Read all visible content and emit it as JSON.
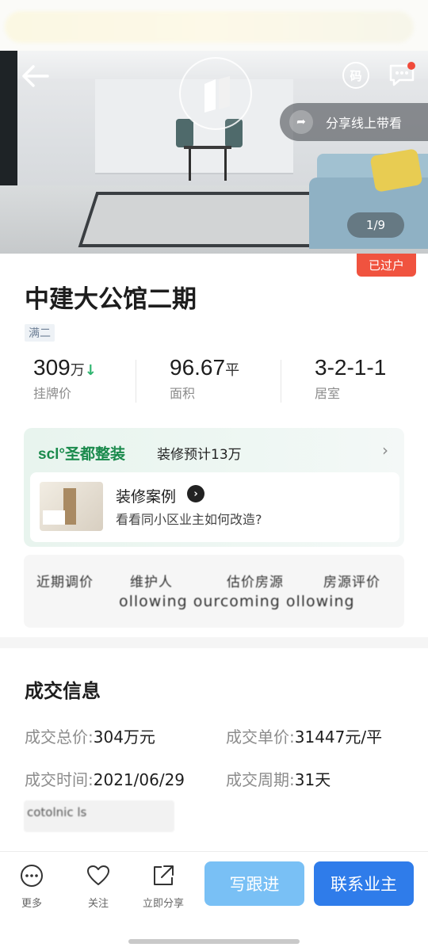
{
  "header": {
    "code_label": "码",
    "share_live": "分享线上带看",
    "photo_counter": "1/9"
  },
  "listing": {
    "status_badge": "已过户",
    "title": "中建大公馆二期",
    "tag": "满二",
    "stats": [
      {
        "value": "309",
        "unit": "万",
        "trend": "↓",
        "label": "挂牌价"
      },
      {
        "value": "96.67",
        "unit": "平",
        "label": "面积"
      },
      {
        "value": "3-2-1-1",
        "label": "居室"
      }
    ]
  },
  "renovation": {
    "brand": "scl°圣都整装",
    "budget": "装修预计13万",
    "case_title": "装修案例",
    "case_subtitle": "看看同小区业主如何改造?"
  },
  "garbled": {
    "line1": [
      "近期调价",
      "维护人",
      "估价房源",
      "房源评价"
    ],
    "line2": "ollowing  ourcoming  ollowing"
  },
  "deal": {
    "section_title": "成交信息",
    "total_price_key": "成交总价:",
    "total_price_val": "304万元",
    "unit_price_key": "成交单价:",
    "unit_price_val": "31447元/平",
    "date_key": "成交时间:",
    "date_val": "2021/06/29",
    "cycle_key": "成交周期:",
    "cycle_val": "31天",
    "blurred": "cotolnic  ls"
  },
  "bottom_bar": {
    "more": "更多",
    "follow": "关注",
    "share": "立即分享",
    "write_followup": "写跟进",
    "contact_owner": "联系业主"
  },
  "colors": {
    "accent_blue": "#2f7cea",
    "light_blue": "#79c0f5",
    "badge_red": "#f0533f",
    "trend_green": "#2db46e",
    "brand_green": "#1a8a4c"
  }
}
